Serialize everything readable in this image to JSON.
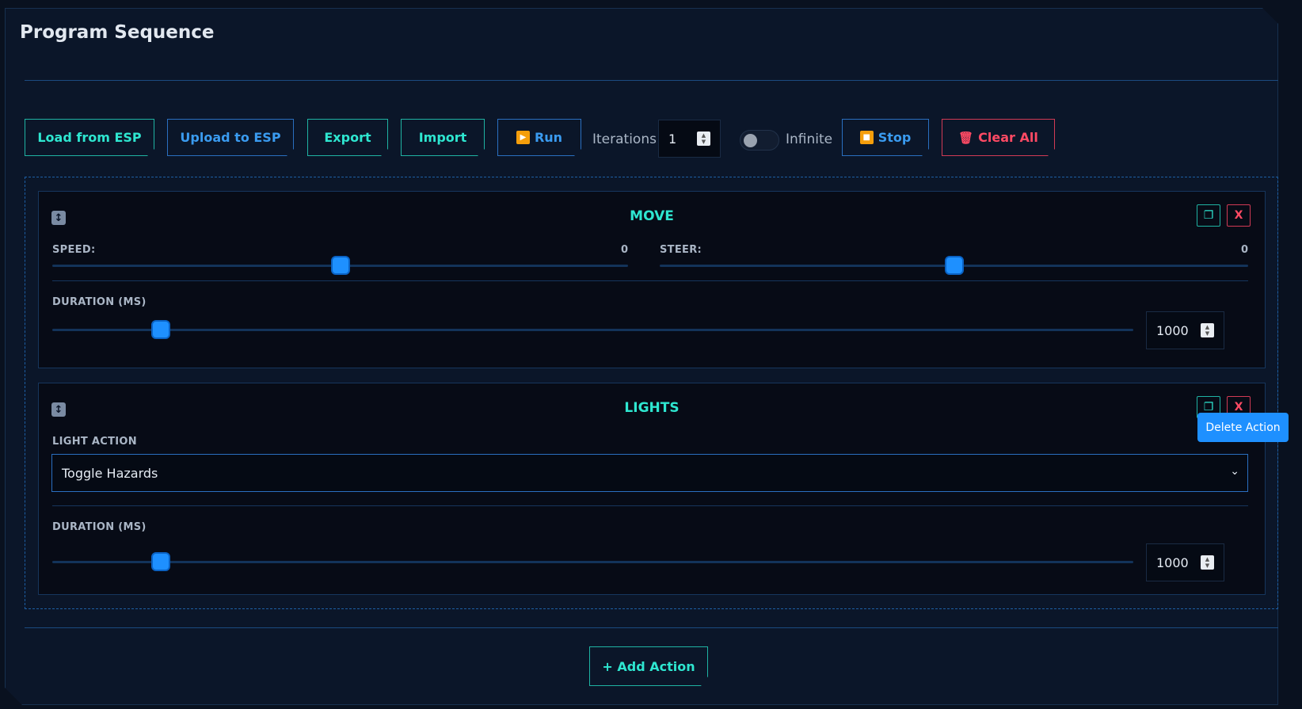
{
  "page": {
    "title": "Program Sequence"
  },
  "toolbar": {
    "load_label": "Load from ESP",
    "upload_label": "Upload to ESP",
    "export_label": "Export",
    "import_label": "Import",
    "run_label": "Run",
    "iterations_label": "Iterations",
    "iterations_value": "1",
    "infinite_label": "Infinite",
    "infinite_on": false,
    "stop_label": "Stop",
    "clear_label": "Clear All"
  },
  "actions": [
    {
      "title": "MOVE",
      "drag_icon": "↕",
      "duplicate_icon": "❐",
      "delete_icon": "X",
      "speed_label": "SPEED:",
      "speed_value": "0",
      "speed_fraction": 0.5,
      "steer_label": "STEER:",
      "steer_value": "0",
      "steer_fraction": 0.5,
      "duration_label": "DURATION (MS)",
      "duration_value": "1000",
      "duration_fraction": 0.1
    },
    {
      "title": "LIGHTS",
      "drag_icon": "↕",
      "duplicate_icon": "❐",
      "delete_icon": "X",
      "light_label": "LIGHT ACTION",
      "light_value": "Toggle Hazards",
      "duration_label": "DURATION (MS)",
      "duration_value": "1000",
      "duration_fraction": 0.1
    }
  ],
  "tooltip": "Delete Action",
  "add_action_label": "+ Add Action",
  "colors": {
    "accent_teal": "#2ee6d0",
    "accent_blue": "#1e90ff",
    "danger": "#ff4a64",
    "background": "#0b1629"
  }
}
